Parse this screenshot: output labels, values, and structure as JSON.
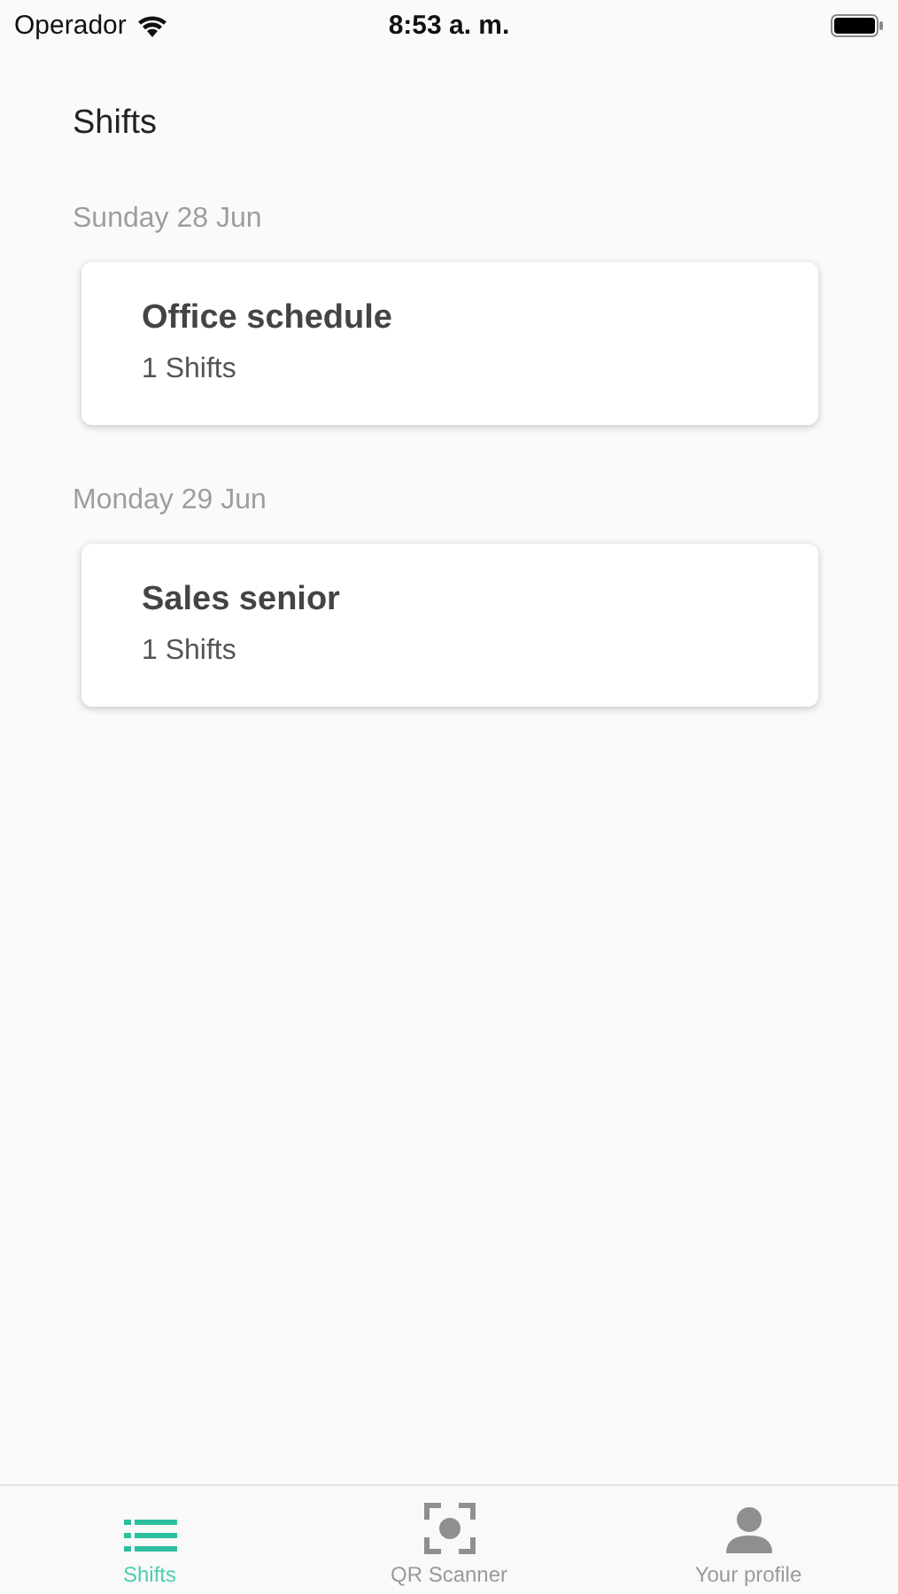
{
  "status_bar": {
    "carrier": "Operador",
    "time": "8:53 a. m."
  },
  "title": "Shifts",
  "groups": [
    {
      "date": "Sunday 28 Jun",
      "cards": [
        {
          "title": "Office schedule",
          "subtitle": "1 Shifts"
        }
      ]
    },
    {
      "date": "Monday 29 Jun",
      "cards": [
        {
          "title": "Sales senior",
          "subtitle": "1 Shifts"
        }
      ]
    }
  ],
  "tabs": [
    {
      "label": "Shifts",
      "kind": "list",
      "selected": true
    },
    {
      "label": "QR Scanner",
      "kind": "scanner",
      "selected": false
    },
    {
      "label": "Your profile",
      "kind": "person",
      "selected": false
    }
  ]
}
